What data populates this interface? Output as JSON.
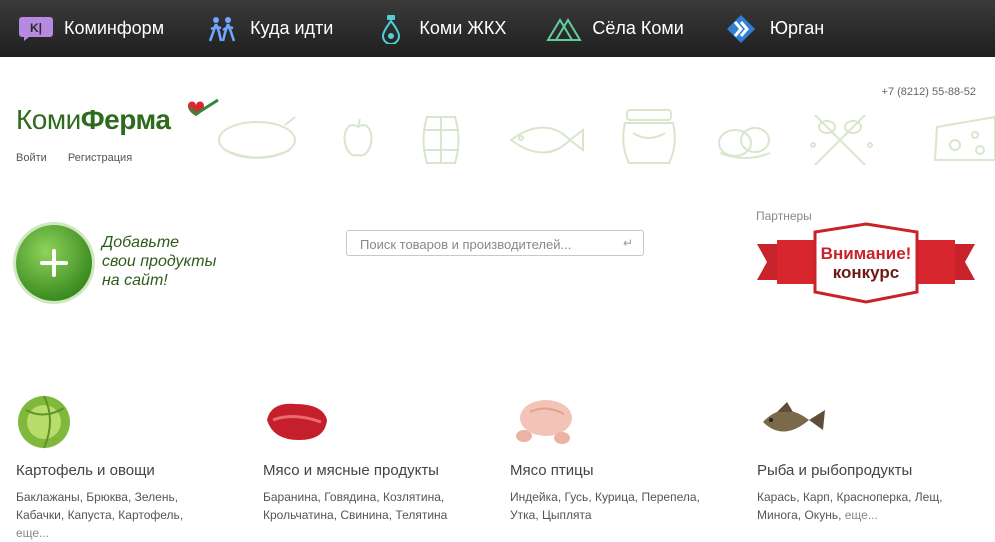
{
  "topnav": [
    {
      "label": "Коминформ",
      "icon": "kominform-logo-icon"
    },
    {
      "label": "Куда идти",
      "icon": "people-walking-icon"
    },
    {
      "label": "Коми ЖКХ",
      "icon": "faucet-drop-icon"
    },
    {
      "label": "Сёла Коми",
      "icon": "tent-village-icon"
    },
    {
      "label": "Юрган",
      "icon": "chevrons-right-icon"
    }
  ],
  "header": {
    "phone": "+7 (8212) 55-88-52",
    "logo_part1": "Коми",
    "logo_part2": "Ферма",
    "login": "Войти",
    "register": "Регистрация"
  },
  "add": {
    "text_line1": "Добавьте",
    "text_line2": "свои продукты",
    "text_line3": "на сайт!"
  },
  "search": {
    "placeholder": "Поиск товаров и производителей..."
  },
  "partners": {
    "label": "Партнеры",
    "banner_line1": "Внимание!",
    "banner_line2": "конкурс"
  },
  "categories": [
    {
      "title": "Картофель и овощи",
      "items": [
        "Баклажаны",
        "Брюква",
        "Зелень",
        "Кабачки",
        "Капуста",
        "Картофель"
      ],
      "more": "еще..."
    },
    {
      "title": "Мясо и мясные продукты",
      "items": [
        "Баранина",
        "Говядина",
        "Козлятина",
        "Крольчатина",
        "Свинина",
        "Телятина"
      ],
      "more": ""
    },
    {
      "title": "Мясо птицы",
      "items": [
        "Индейка",
        "Гусь",
        "Курица",
        "Перепела",
        "Утка",
        "Цыплята"
      ],
      "more": ""
    },
    {
      "title": "Рыба и рыбопродукты",
      "items": [
        "Карась",
        "Карп",
        "Красноперка",
        "Лещ",
        "Минога",
        "Окунь"
      ],
      "more": "еще..."
    }
  ]
}
